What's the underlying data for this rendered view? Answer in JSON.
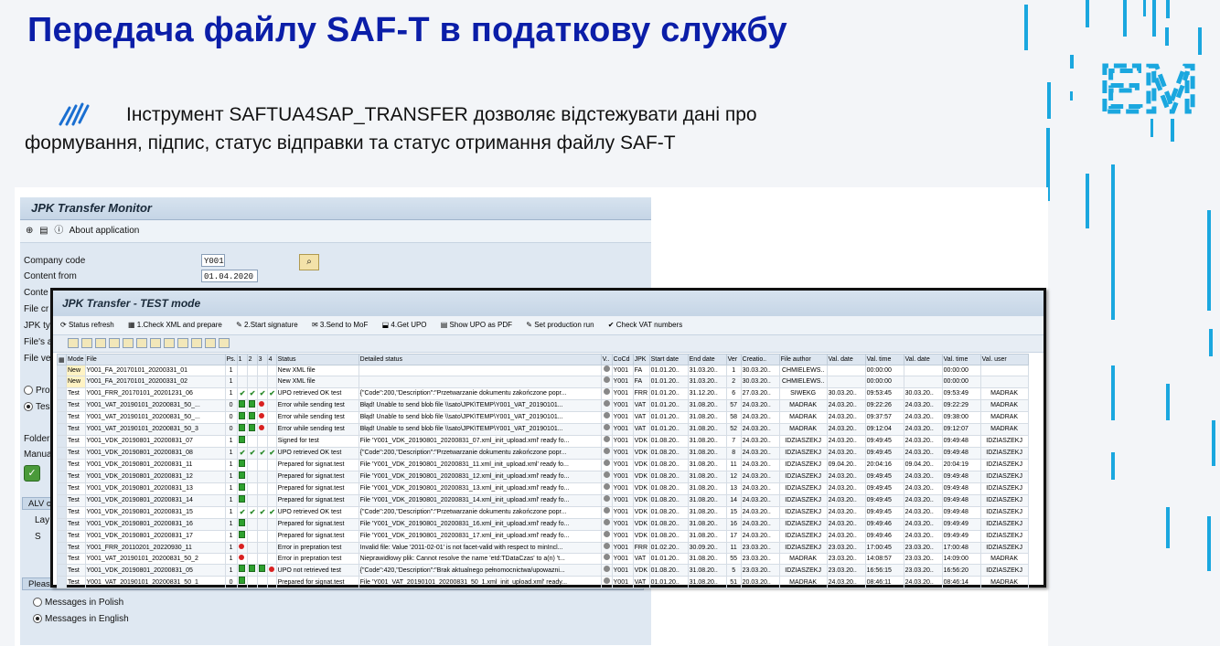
{
  "slide": {
    "title": "Передача файлу SAF-T в податкову службу",
    "description_line1": "Інструмент SAFTUA4SAP_TRANSFER дозволяє відстежувати дані про",
    "description_line2": "формування, підпис, статус відправки та статус отримання файлу SAF-T",
    "logo_text": "EM",
    "accent_color": "#0b1ea8",
    "logo_color": "#1aa7df"
  },
  "monitor": {
    "title": "JPK Transfer Monitor",
    "toolbar_about": "About application",
    "company_code_label": "Company code",
    "company_code_value": "Y001",
    "content_from_label": "Content from",
    "content_from_value": "01.04.2020",
    "frag_conte": "Conte",
    "frag_file_cr": "File cr",
    "frag_jpk_ty": "JPK ty",
    "frag_files_a": "File's a",
    "frag_file_ve": "File ve",
    "frag_pro": "Pro",
    "frag_tes": "Tes",
    "frag_folder": "Folder",
    "frag_manua": "Manua",
    "frag_alv": "ALV o",
    "frag_lay": "Lay",
    "frag_s": "S",
    "language_group": "Please choose a language for messages from JAVA Engine",
    "lang_polish": "Messages in Polish",
    "lang_english": "Messages in English"
  },
  "transfer": {
    "title": "JPK Transfer - TEST mode",
    "toolbar": [
      "Status refresh",
      "1.Check XML and prepare",
      "2.Start signature",
      "3.Send to MoF",
      "4.Get UPO",
      "Show UPO as PDF",
      "Set production run",
      "Check VAT numbers"
    ],
    "columns": [
      "Mode",
      "File",
      "Ps.",
      "1",
      "2",
      "3",
      "4",
      "Status",
      "Detailed status",
      "V..",
      "CoCd",
      "JPK",
      "Start date",
      "End date",
      "Ver",
      "Creatio..",
      "File author",
      "Val. date",
      "Val. time",
      "Val. date",
      "Val. time",
      "Val. user"
    ],
    "rows": [
      {
        "mode": "New",
        "file": "Y001_FA_20170101_20200331_01",
        "ps": "1",
        "lamps": "",
        "status": "New XML file",
        "detail": "",
        "cocd": "Y001",
        "jpk": "FA",
        "start": "01.01.20..",
        "end": "31.03.20..",
        "ver": "1",
        "created": "30.03.20..",
        "author": "CHMIELEWS..",
        "vdate1": "",
        "vtime1": "00:00:00",
        "vdate2": "",
        "vtime2": "00:00:00",
        "vuser": ""
      },
      {
        "mode": "New",
        "file": "Y001_FA_20170101_20200331_02",
        "ps": "1",
        "lamps": "",
        "status": "New XML file",
        "detail": "",
        "cocd": "Y001",
        "jpk": "FA",
        "start": "01.01.20..",
        "end": "31.03.20..",
        "ver": "2",
        "created": "30.03.20..",
        "author": "CHMIELEWS..",
        "vdate1": "",
        "vtime1": "00:00:00",
        "vdate2": "",
        "vtime2": "00:00:00",
        "vuser": ""
      },
      {
        "mode": "Test",
        "file": "Y001_FRR_20170101_20201231_06",
        "ps": "1",
        "lamps": "check4",
        "status": "UPO retrieved OK test",
        "detail": "{\"Code\":200,\"Description\":\"Przetwarzanie dokumentu zakończone popr...",
        "cocd": "Y001",
        "jpk": "FRR",
        "start": "01.01.20..",
        "end": "31.12.20..",
        "ver": "6",
        "created": "27.03.20..",
        "author": "SIWEKG",
        "vdate1": "30.03.20..",
        "vtime1": "09:53:45",
        "vdate2": "30.03.20..",
        "vtime2": "09:53:49",
        "vuser": "MADRAK"
      },
      {
        "mode": "Test",
        "file": "Y001_VAT_20190101_20200831_50_...",
        "ps": "0",
        "lamps": "ggr",
        "status": "Error while sending test",
        "detail": "Błąd! Unable to send blob file \\\\sato\\JPK\\TEMP\\Y001_VAT_20190101...",
        "cocd": "Y001",
        "jpk": "VAT",
        "start": "01.01.20..",
        "end": "31.08.20..",
        "ver": "57",
        "created": "24.03.20..",
        "author": "MADRAK",
        "vdate1": "24.03.20..",
        "vtime1": "09:22:26",
        "vdate2": "24.03.20..",
        "vtime2": "09:22:29",
        "vuser": "MADRAK"
      },
      {
        "mode": "Test",
        "file": "Y001_VAT_20190101_20200831_50_...",
        "ps": "0",
        "lamps": "ggr",
        "status": "Error while sending test",
        "detail": "Błąd! Unable to send blob file \\\\sato\\JPK\\TEMP\\Y001_VAT_20190101...",
        "cocd": "Y001",
        "jpk": "VAT",
        "start": "01.01.20..",
        "end": "31.08.20..",
        "ver": "58",
        "created": "24.03.20..",
        "author": "MADRAK",
        "vdate1": "24.03.20..",
        "vtime1": "09:37:57",
        "vdate2": "24.03.20..",
        "vtime2": "09:38:00",
        "vuser": "MADRAK"
      },
      {
        "mode": "Test",
        "file": "Y001_VAT_20190101_20200831_50_3",
        "ps": "0",
        "lamps": "ggr",
        "status": "Error while sending test",
        "detail": "Błąd! Unable to send blob file \\\\sato\\JPK\\TEMP\\Y001_VAT_20190101...",
        "cocd": "Y001",
        "jpk": "VAT",
        "start": "01.01.20..",
        "end": "31.08.20..",
        "ver": "52",
        "created": "24.03.20..",
        "author": "MADRAK",
        "vdate1": "24.03.20..",
        "vtime1": "09:12:04",
        "vdate2": "24.03.20..",
        "vtime2": "09:12:07",
        "vuser": "MADRAK"
      },
      {
        "mode": "Test",
        "file": "Y001_VDK_20190801_20200831_07",
        "ps": "1",
        "lamps": "g",
        "status": "Signed for test",
        "detail": "File 'Y001_VDK_20190801_20200831_07.xml_init_upload.xml' ready fo...",
        "cocd": "Y001",
        "jpk": "VDK",
        "start": "01.08.20..",
        "end": "31.08.20..",
        "ver": "7",
        "created": "24.03.20..",
        "author": "IDZIASZEKJ",
        "vdate1": "24.03.20..",
        "vtime1": "09:49:45",
        "vdate2": "24.03.20..",
        "vtime2": "09:49:48",
        "vuser": "IDZIASZEKJ"
      },
      {
        "mode": "Test",
        "file": "Y001_VDK_20190801_20200831_08",
        "ps": "1",
        "lamps": "check4",
        "status": "UPO retrieved OK test",
        "detail": "{\"Code\":200,\"Description\":\"Przetwarzanie dokumentu zakończone popr...",
        "cocd": "Y001",
        "jpk": "VDK",
        "start": "01.08.20..",
        "end": "31.08.20..",
        "ver": "8",
        "created": "24.03.20..",
        "author": "IDZIASZEKJ",
        "vdate1": "24.03.20..",
        "vtime1": "09:49:45",
        "vdate2": "24.03.20..",
        "vtime2": "09:49:48",
        "vuser": "IDZIASZEKJ"
      },
      {
        "mode": "Test",
        "file": "Y001_VDK_20190801_20200831_11",
        "ps": "1",
        "lamps": "g",
        "status": "Prepared for signat.test",
        "detail": "File 'Y001_VDK_20190801_20200831_11.xml_init_upload.xml' ready fo...",
        "cocd": "Y001",
        "jpk": "VDK",
        "start": "01.08.20..",
        "end": "31.08.20..",
        "ver": "11",
        "created": "24.03.20..",
        "author": "IDZIASZEKJ",
        "vdate1": "09.04.20..",
        "vtime1": "20:04:16",
        "vdate2": "09.04.20..",
        "vtime2": "20:04:19",
        "vuser": "IDZIASZEKJ"
      },
      {
        "mode": "Test",
        "file": "Y001_VDK_20190801_20200831_12",
        "ps": "1",
        "lamps": "g",
        "status": "Prepared for signat.test",
        "detail": "File 'Y001_VDK_20190801_20200831_12.xml_init_upload.xml' ready fo...",
        "cocd": "Y001",
        "jpk": "VDK",
        "start": "01.08.20..",
        "end": "31.08.20..",
        "ver": "12",
        "created": "24.03.20..",
        "author": "IDZIASZEKJ",
        "vdate1": "24.03.20..",
        "vtime1": "09:49:45",
        "vdate2": "24.03.20..",
        "vtime2": "09:49:48",
        "vuser": "IDZIASZEKJ"
      },
      {
        "mode": "Test",
        "file": "Y001_VDK_20190801_20200831_13",
        "ps": "1",
        "lamps": "g",
        "status": "Prepared for signat.test",
        "detail": "File 'Y001_VDK_20190801_20200831_13.xml_init_upload.xml' ready fo...",
        "cocd": "Y001",
        "jpk": "VDK",
        "start": "01.08.20..",
        "end": "31.08.20..",
        "ver": "13",
        "created": "24.03.20..",
        "author": "IDZIASZEKJ",
        "vdate1": "24.03.20..",
        "vtime1": "09:49:45",
        "vdate2": "24.03.20..",
        "vtime2": "09:49:48",
        "vuser": "IDZIASZEKJ"
      },
      {
        "mode": "Test",
        "file": "Y001_VDK_20190801_20200831_14",
        "ps": "1",
        "lamps": "g",
        "status": "Prepared for signat.test",
        "detail": "File 'Y001_VDK_20190801_20200831_14.xml_init_upload.xml' ready fo...",
        "cocd": "Y001",
        "jpk": "VDK",
        "start": "01.08.20..",
        "end": "31.08.20..",
        "ver": "14",
        "created": "24.03.20..",
        "author": "IDZIASZEKJ",
        "vdate1": "24.03.20..",
        "vtime1": "09:49:45",
        "vdate2": "24.03.20..",
        "vtime2": "09:49:48",
        "vuser": "IDZIASZEKJ"
      },
      {
        "mode": "Test",
        "file": "Y001_VDK_20190801_20200831_15",
        "ps": "1",
        "lamps": "check4",
        "status": "UPO retrieved OK test",
        "detail": "{\"Code\":200,\"Description\":\"Przetwarzanie dokumentu zakończone popr...",
        "cocd": "Y001",
        "jpk": "VDK",
        "start": "01.08.20..",
        "end": "31.08.20..",
        "ver": "15",
        "created": "24.03.20..",
        "author": "IDZIASZEKJ",
        "vdate1": "24.03.20..",
        "vtime1": "09:49:45",
        "vdate2": "24.03.20..",
        "vtime2": "09:49:48",
        "vuser": "IDZIASZEKJ"
      },
      {
        "mode": "Test",
        "file": "Y001_VDK_20190801_20200831_16",
        "ps": "1",
        "lamps": "g",
        "status": "Prepared for signat.test",
        "detail": "File 'Y001_VDK_20190801_20200831_16.xml_init_upload.xml' ready fo...",
        "cocd": "Y001",
        "jpk": "VDK",
        "start": "01.08.20..",
        "end": "31.08.20..",
        "ver": "16",
        "created": "24.03.20..",
        "author": "IDZIASZEKJ",
        "vdate1": "24.03.20..",
        "vtime1": "09:49:46",
        "vdate2": "24.03.20..",
        "vtime2": "09:49:49",
        "vuser": "IDZIASZEKJ"
      },
      {
        "mode": "Test",
        "file": "Y001_VDK_20190801_20200831_17",
        "ps": "1",
        "lamps": "g",
        "status": "Prepared for signat.test",
        "detail": "File 'Y001_VDK_20190801_20200831_17.xml_init_upload.xml' ready fo...",
        "cocd": "Y001",
        "jpk": "VDK",
        "start": "01.08.20..",
        "end": "31.08.20..",
        "ver": "17",
        "created": "24.03.20..",
        "author": "IDZIASZEKJ",
        "vdate1": "24.03.20..",
        "vtime1": "09:49:46",
        "vdate2": "24.03.20..",
        "vtime2": "09:49:49",
        "vuser": "IDZIASZEKJ"
      },
      {
        "mode": "Test",
        "file": "Y001_FRR_20110201_20220930_11",
        "ps": "1",
        "lamps": "r",
        "status": "Error in prepration test",
        "detail": "Invalid file: Value '2011-02-01' is not facet-valid with respect to minIncl...",
        "cocd": "Y001",
        "jpk": "FRR",
        "start": "01.02.20..",
        "end": "30.09.20..",
        "ver": "11",
        "created": "23.03.20..",
        "author": "IDZIASZEKJ",
        "vdate1": "23.03.20..",
        "vtime1": "17:00:45",
        "vdate2": "23.03.20..",
        "vtime2": "17:00:48",
        "vuser": "IDZIASZEKJ"
      },
      {
        "mode": "Test",
        "file": "Y001_VAT_20190101_20200831_50_2",
        "ps": "1",
        "lamps": "r",
        "status": "Error in prepration test",
        "detail": "Nieprawidłowy plik: Cannot resolve the name 'etd:TDataCzas' to a(n) 't...",
        "cocd": "Y001",
        "jpk": "VAT",
        "start": "01.01.20..",
        "end": "31.08.20..",
        "ver": "55",
        "created": "23.03.20..",
        "author": "MADRAK",
        "vdate1": "23.03.20..",
        "vtime1": "14:08:57",
        "vdate2": "23.03.20..",
        "vtime2": "14:09:00",
        "vuser": "MADRAK"
      },
      {
        "mode": "Test",
        "file": "Y001_VDK_20190801_20200831_05",
        "ps": "1",
        "lamps": "gggr",
        "status": "UPO not retrieved test",
        "detail": "{\"Code\":420,\"Description\":\"Brak aktualnego pełnomocnictwa/upowazni...",
        "cocd": "Y001",
        "jpk": "VDK",
        "start": "01.08.20..",
        "end": "31.08.20..",
        "ver": "5",
        "created": "23.03.20..",
        "author": "IDZIASZEKJ",
        "vdate1": "23.03.20..",
        "vtime1": "16:56:15",
        "vdate2": "23.03.20..",
        "vtime2": "16:56:20",
        "vuser": "IDZIASZEKJ"
      },
      {
        "mode": "Test",
        "file": "Y001_VAT_20190101_20200831_50_1",
        "ps": "0",
        "lamps": "g",
        "status": "Prepared for signat.test",
        "detail": "File 'Y001_VAT_20190101_20200831_50_1.xml_init_upload.xml' ready...",
        "cocd": "Y001",
        "jpk": "VAT",
        "start": "01.01.20..",
        "end": "31.08.20..",
        "ver": "51",
        "created": "20.03.20..",
        "author": "MADRAK",
        "vdate1": "24.03.20..",
        "vtime1": "08:46:11",
        "vdate2": "24.03.20..",
        "vtime2": "08:46:14",
        "vuser": "MADRAK"
      }
    ]
  }
}
